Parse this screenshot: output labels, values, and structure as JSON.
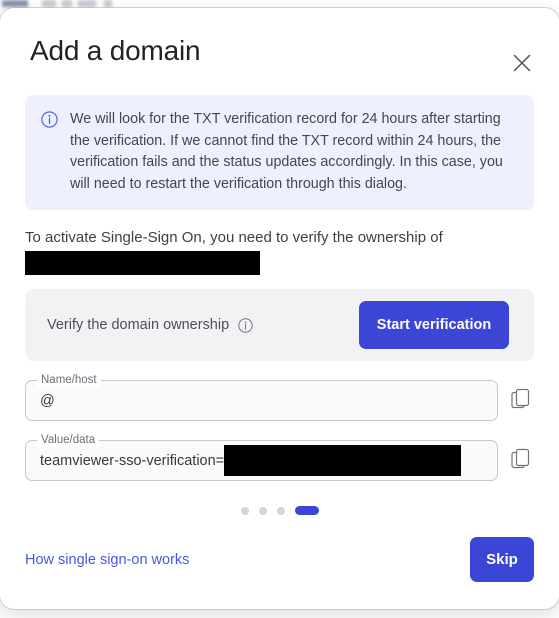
{
  "modal": {
    "title": "Add a domain",
    "close_icon": "close-icon"
  },
  "info_banner": {
    "icon": "info-circle-icon",
    "text": "We will look for the TXT verification record for 24 hours after starting the verification. If we cannot find the TXT record within 24 hours, the verification fails and the status updates accordingly. In this case, you will need to restart the verification through this dialog.",
    "background": "#eef0fb",
    "icon_color": "#4a56e0"
  },
  "activate": {
    "text": "To activate Single-Sign On, you need to verify the ownership of",
    "domain_redacted": true
  },
  "verify_card": {
    "label": "Verify the domain ownership",
    "info_icon": "info-circle-icon",
    "button_label": "Start verification",
    "button_color": "#3b45d6",
    "background": "#f2f2f5"
  },
  "fields": [
    {
      "legend": "Name/host",
      "value": "@",
      "redacted": false,
      "copy_icon": "copy-icon"
    },
    {
      "legend": "Value/data",
      "value": "teamviewer-sso-verification=",
      "redacted": true,
      "copy_icon": "copy-icon"
    }
  ],
  "steps": {
    "total": 4,
    "active_index": 3,
    "active_color": "#3b45d6",
    "inactive_color": "#d3d4d8"
  },
  "footer": {
    "link_label": "How single sign-on works",
    "link_color": "#4a56e0",
    "skip_label": "Skip",
    "skip_color": "#3b45d6"
  }
}
